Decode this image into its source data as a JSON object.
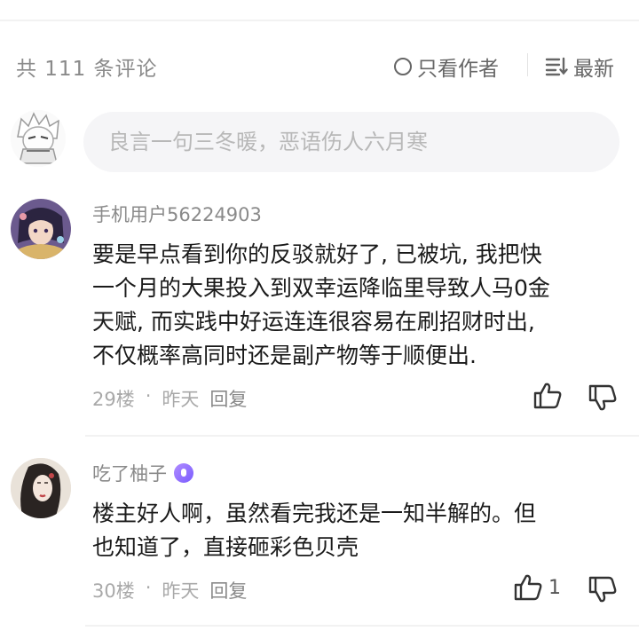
{
  "header": {
    "comment_count": "共 111 条评论",
    "only_author_label": "只看作者",
    "sort_label": "最新"
  },
  "composer": {
    "placeholder": "良言一句三冬暖，恶语伤人六月寒"
  },
  "comments": [
    {
      "username": "手机用户56224903",
      "text": "要是早点看到你的反驳就好了, 已被坑, 我把快\n一个月的大果投入到双幸运降临里导致人马0金\n天赋, 而实践中好运连连很容易在刷招财时出,\n不仅概率高同时还是副产物等于顺便出.",
      "floor": "29楼",
      "time": "昨天",
      "reply_label": "回复",
      "likes": ""
    },
    {
      "username": "吃了柚子",
      "text": "楼主好人啊，虽然看完我还是一知半解的。但\n也知道了，直接砸彩色贝壳",
      "floor": "30楼",
      "time": "昨天",
      "reply_label": "回复",
      "likes": "1"
    }
  ],
  "meta_separator": "·"
}
